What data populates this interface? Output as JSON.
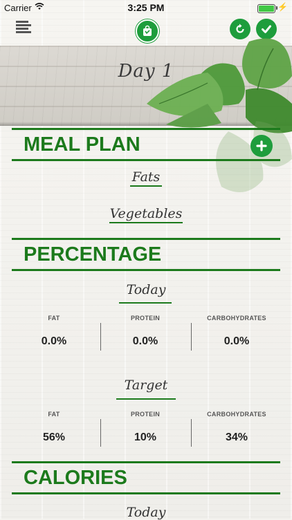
{
  "status_bar": {
    "carrier": "Carrier",
    "time": "3:25 PM"
  },
  "header": {
    "title": "Day 1"
  },
  "meal_plan": {
    "title": "MEAL PLAN",
    "items": [
      {
        "label": "Fats"
      },
      {
        "label": "Vegetables"
      }
    ]
  },
  "percentage": {
    "title": "PERCENTAGE",
    "today": {
      "label": "Today",
      "columns": [
        {
          "head": "FAT",
          "value": "0.0%"
        },
        {
          "head": "PROTEIN",
          "value": "0.0%"
        },
        {
          "head": "CARBOHYDRATES",
          "value": "0.0%"
        }
      ]
    },
    "target": {
      "label": "Target",
      "columns": [
        {
          "head": "FAT",
          "value": "56%"
        },
        {
          "head": "PROTEIN",
          "value": "10%"
        },
        {
          "head": "CARBOHYDRATES",
          "value": "34%"
        }
      ]
    }
  },
  "calories": {
    "title": "CALORIES",
    "today_label": "Today"
  },
  "colors": {
    "accent_green": "#1c7a1c",
    "button_green": "#1e9d3c"
  },
  "icons": [
    "menu-icon",
    "app-logo-icon",
    "refresh-icon",
    "check-icon",
    "plus-icon",
    "wifi-icon",
    "battery-icon"
  ]
}
